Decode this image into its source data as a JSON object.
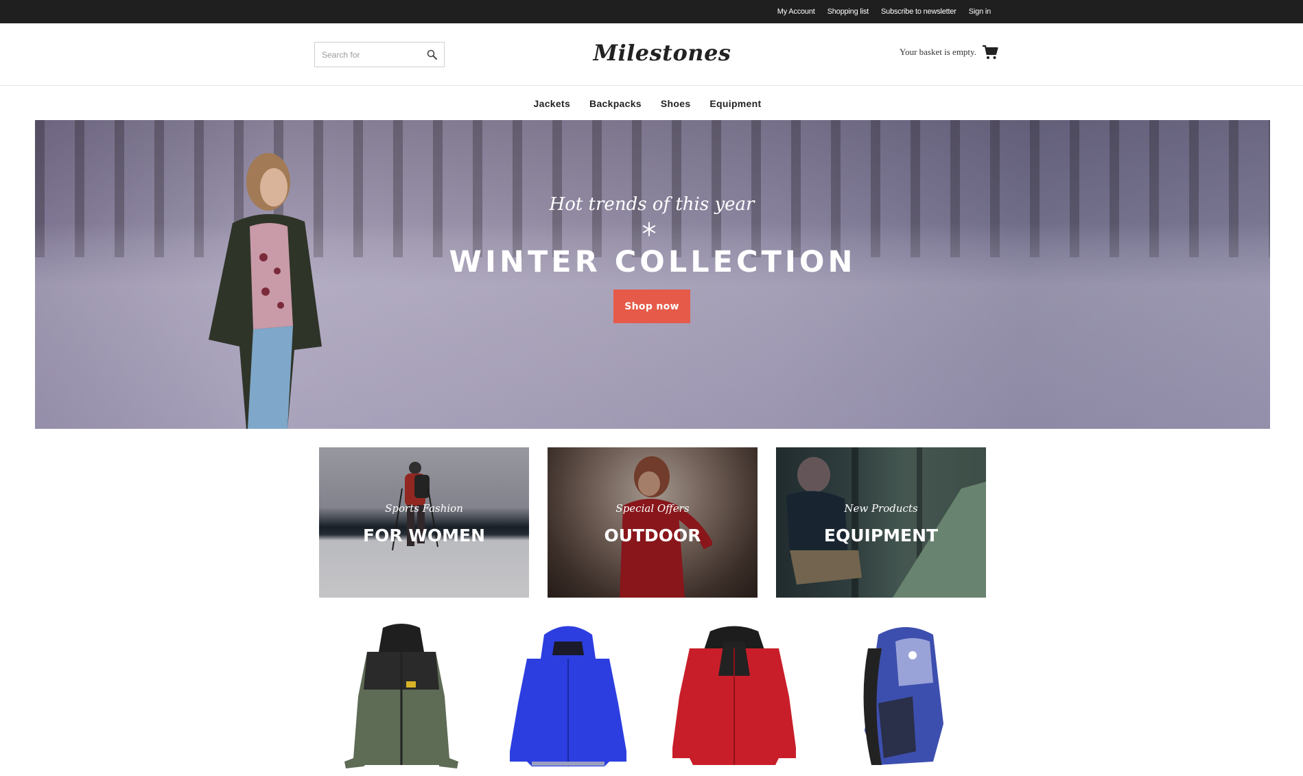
{
  "topbar": {
    "links": [
      "My Account",
      "Shopping list",
      "Subscribe to newsletter",
      "Sign in"
    ]
  },
  "header": {
    "search_placeholder": "Search for",
    "logo": "Milestones",
    "basket_text": "Your basket is empty."
  },
  "nav": {
    "items": [
      "Jackets",
      "Backpacks",
      "Shoes",
      "Equipment"
    ]
  },
  "hero": {
    "subtitle": "Hot trends of this year",
    "title": "WINTER COLLECTION",
    "cta": "Shop now"
  },
  "tiles": [
    {
      "subtitle": "Sports Fashion",
      "title": "FOR WOMEN"
    },
    {
      "subtitle": "Special Offers",
      "title": "OUTDOOR"
    },
    {
      "subtitle": "New Products",
      "title": "EQUIPMENT"
    }
  ],
  "products": [
    {
      "name": "green-fleece-jacket",
      "color": "#5e6b55"
    },
    {
      "name": "blue-rain-jacket",
      "color": "#2c3ee0"
    },
    {
      "name": "red-jacket",
      "color": "#c81e2a"
    },
    {
      "name": "blue-backpack",
      "color": "#3d4fae"
    }
  ],
  "colors": {
    "topbar_bg": "#1f1f1f",
    "cta": "#e55a48"
  }
}
